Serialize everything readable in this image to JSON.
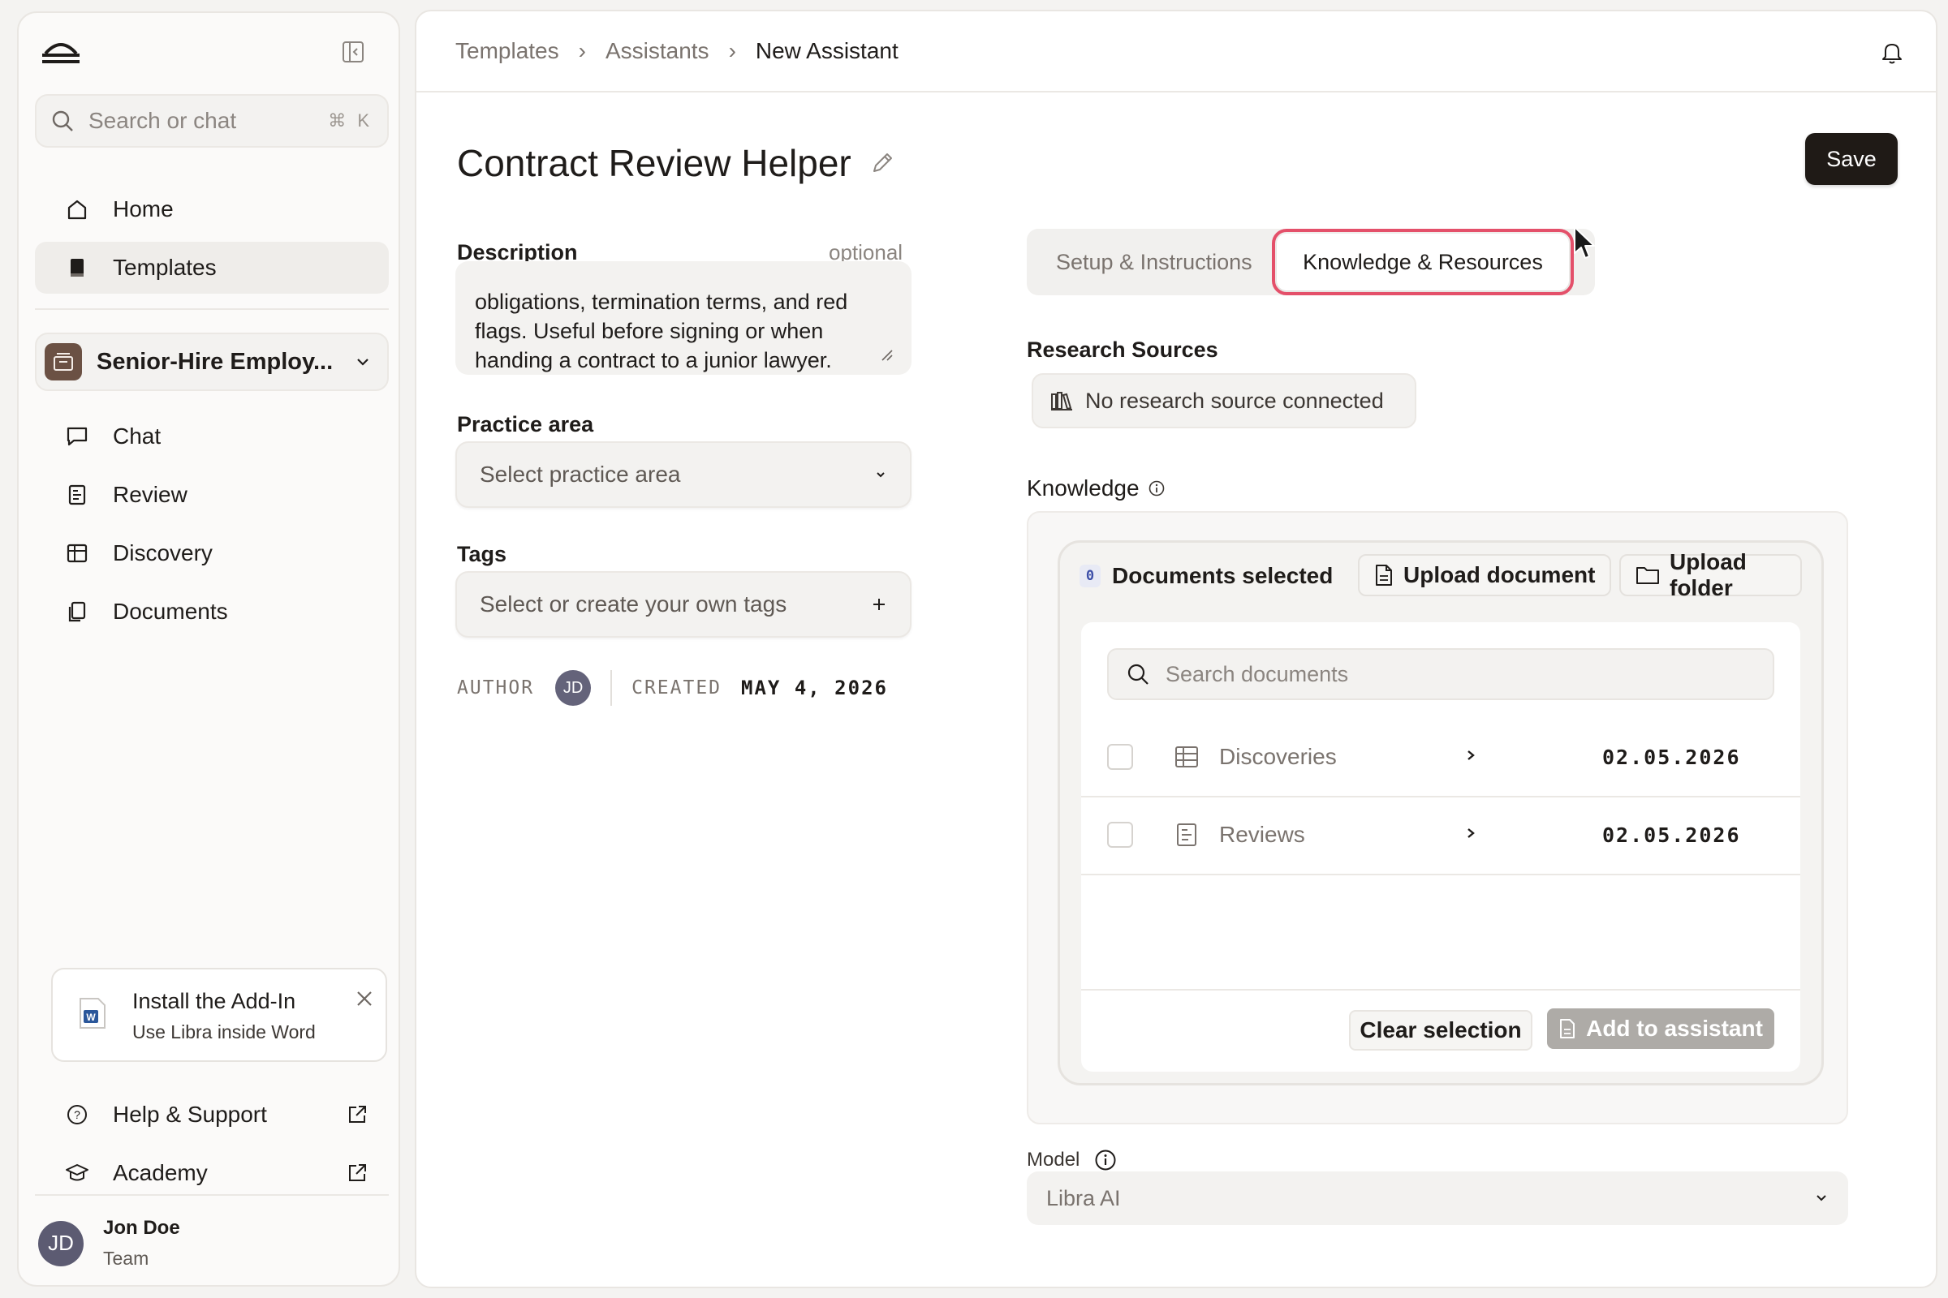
{
  "sidebar": {
    "search_placeholder": "Search or chat",
    "search_shortcut": "⌘ K",
    "nav": [
      {
        "label": "Home",
        "icon": "home-icon"
      },
      {
        "label": "Templates",
        "icon": "book-icon",
        "active": true
      }
    ],
    "workspace": {
      "name": "Senior-Hire Employ..."
    },
    "workspace_nav": [
      {
        "label": "Chat",
        "icon": "chat-icon"
      },
      {
        "label": "Review",
        "icon": "review-icon"
      },
      {
        "label": "Discovery",
        "icon": "table-icon"
      },
      {
        "label": "Documents",
        "icon": "documents-icon"
      }
    ],
    "addin": {
      "title": "Install the Add-In",
      "subtitle": "Use Libra inside Word",
      "word_letter": "W"
    },
    "footer_links": [
      {
        "label": "Help & Support",
        "icon": "help-icon"
      },
      {
        "label": "Academy",
        "icon": "academy-icon"
      }
    ],
    "user": {
      "initials": "JD",
      "name": "Jon Doe",
      "role": "Team"
    }
  },
  "header": {
    "breadcrumbs": [
      "Templates",
      "Assistants",
      "New Assistant"
    ],
    "separator": "›"
  },
  "editor": {
    "title": "Contract Review Helper",
    "save_label": "Save",
    "description": {
      "label": "Description",
      "optional": "optional",
      "value": "obligations, termination terms, and red flags. Useful before signing or when handing a contract to a junior lawyer."
    },
    "practice_area": {
      "label": "Practice area",
      "placeholder": "Select practice area"
    },
    "tags": {
      "label": "Tags",
      "placeholder": "Select or create your own tags"
    },
    "meta": {
      "author_label": "AUTHOR",
      "author_initials": "JD",
      "created_label": "CREATED",
      "created_value": "MAY 4, 2026"
    }
  },
  "tabs": [
    {
      "label": "Setup & Instructions",
      "active": false
    },
    {
      "label": "Knowledge & Resources",
      "active": true
    }
  ],
  "research": {
    "label": "Research Sources",
    "chip": "No research source connected"
  },
  "knowledge": {
    "label": "Knowledge",
    "selected_count": "0",
    "selected_label": "Documents selected",
    "upload_document": "Upload document",
    "upload_folder": "Upload folder",
    "search_placeholder": "Search documents",
    "rows": [
      {
        "name": "Discoveries",
        "date": "02.05.2026",
        "icon": "table-icon"
      },
      {
        "name": "Reviews",
        "date": "02.05.2026",
        "icon": "review-icon"
      }
    ],
    "clear_selection": "Clear selection",
    "add_to_assistant": "Add to assistant"
  },
  "model": {
    "label": "Model",
    "value": "Libra AI"
  },
  "colors": {
    "accent_outline": "#e4506a",
    "primary_button": "#1f1a16",
    "disabled_button": "#aeaba7"
  }
}
